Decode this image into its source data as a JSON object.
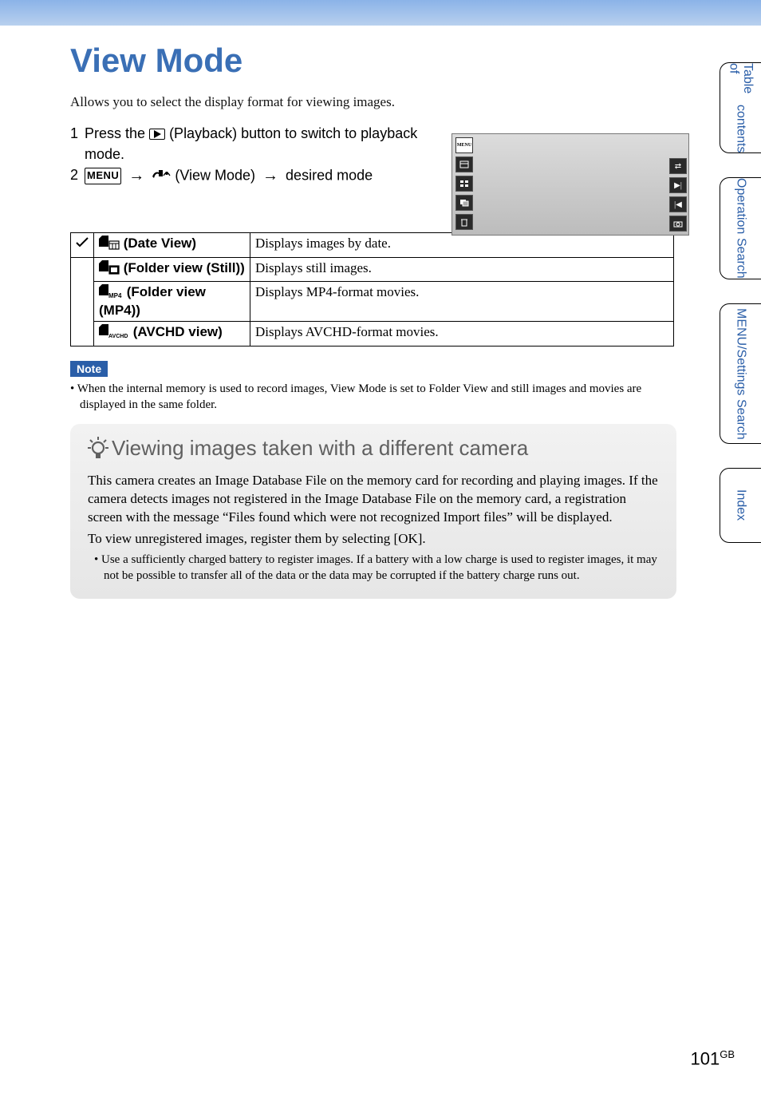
{
  "title": "View Mode",
  "intro": "Allows you to select the display format for viewing images.",
  "steps": {
    "s1_num": "1",
    "s1_a": "Press the ",
    "s1_b": " (Playback) button to switch to playback mode.",
    "s2_num": "2",
    "s2_menu": "MENU",
    "s2_mid": " (View Mode) ",
    "s2_end": " desired mode"
  },
  "thumb": {
    "menu": "MENU",
    "left_icons": [
      "menu",
      "calendar",
      "grid",
      "overlap",
      "trash"
    ],
    "right_icons": [
      "arrows",
      "next",
      "prev",
      "camera"
    ]
  },
  "table": {
    "rows": [
      {
        "check": "✓",
        "label": " (Date View)",
        "desc": "Displays images by date."
      },
      {
        "check": "",
        "label": " (Folder view (Still))",
        "desc": "Displays still images."
      },
      {
        "check": "",
        "label": " (Folder view (MP4))",
        "desc": "Displays MP4-format movies."
      },
      {
        "check": "",
        "label": " (AVCHD view)",
        "desc": "Displays AVCHD-format movies."
      }
    ]
  },
  "note": {
    "heading": "Note",
    "text": "• When the internal memory is used to record images, View Mode is set to Folder View and still images and movies are displayed in the same folder."
  },
  "tip": {
    "title": "Viewing images taken with a different camera",
    "p1": "This camera creates an Image Database File on the memory card for recording and playing images. If the camera detects images not registered in the Image Database File on the memory card, a registration screen with the message “Files found which were not recognized Import files” will be displayed.",
    "p2": "To view unregistered images, register them by selecting [OK].",
    "bullet": "• Use a sufficiently charged battery to register images. If a battery with a low charge is used to register images, it may not be possible to transfer all of the data or the data may be corrupted if the battery charge runs out."
  },
  "tabs": {
    "t1a": "Table of",
    "t1b": "contents",
    "t2a": "Operation",
    "t2b": "Search",
    "t3a": "MENU/Settings",
    "t3b": "Search",
    "t4": "Index"
  },
  "page_number": "101",
  "page_suffix": "GB"
}
